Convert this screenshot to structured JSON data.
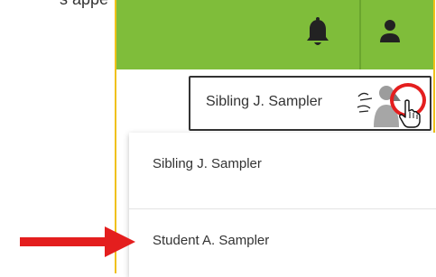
{
  "header": {
    "partial_text": "s appe",
    "bell_icon": "bell-icon",
    "user_icon": "user-icon",
    "bar_color": "#7fbd3a"
  },
  "student_selector": {
    "current_student": "Sibling J. Sampler",
    "avatar_icon": "photo-unavailable-avatar",
    "caret_icon": "caret-up-icon"
  },
  "dropdown": {
    "items": [
      {
        "label": "Sibling J. Sampler"
      },
      {
        "label": "Student A. Sampler"
      }
    ]
  },
  "annotations": {
    "highlight_circle_color": "#e41e1e",
    "arrow_color": "#e41e1e"
  }
}
